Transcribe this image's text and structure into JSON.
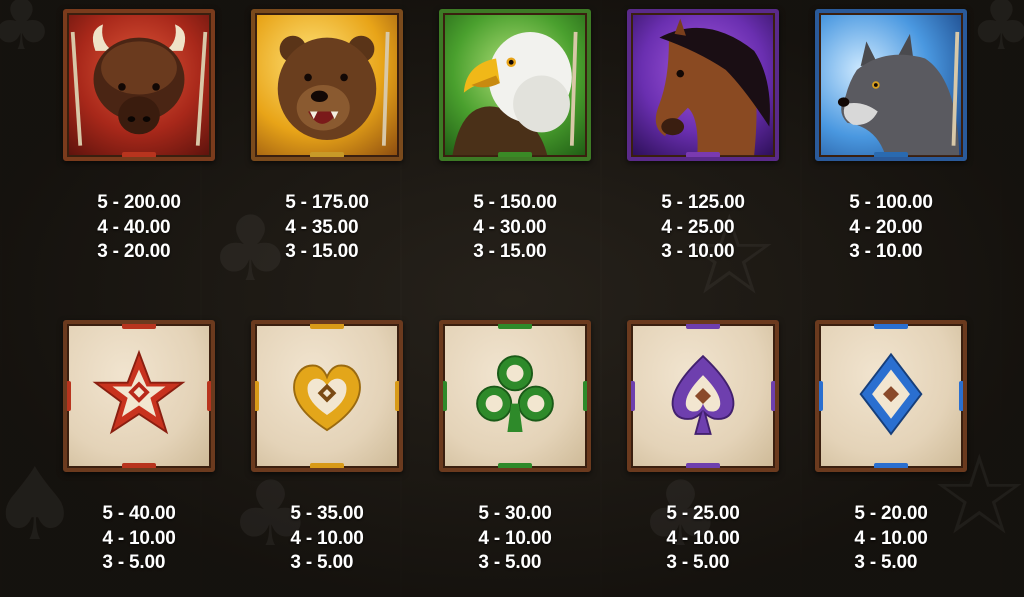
{
  "symbols": [
    {
      "id": "buffalo",
      "icon": "buffalo-icon",
      "bg": "#b3321e",
      "frame": "#7a3b1c",
      "pays": [
        "5 - 200.00",
        "4 - 40.00",
        "3 - 20.00"
      ]
    },
    {
      "id": "bear",
      "icon": "bear-icon",
      "bg": "#e8b020",
      "frame": "#7a4a1c",
      "pays": [
        "5 - 175.00",
        "4 - 35.00",
        "3 - 15.00"
      ]
    },
    {
      "id": "eagle",
      "icon": "eagle-icon",
      "bg": "#3f9a2e",
      "frame": "#3d7a25",
      "pays": [
        "5 - 150.00",
        "4 - 30.00",
        "3 - 15.00"
      ]
    },
    {
      "id": "horse",
      "icon": "horse-icon",
      "bg": "#6a2fb0",
      "frame": "#5a2a8a",
      "pays": [
        "5 - 125.00",
        "4 - 25.00",
        "3 - 10.00"
      ]
    },
    {
      "id": "wolf",
      "icon": "wolf-icon",
      "bg": "#2f7fd0",
      "frame": "#2a5a9a",
      "pays": [
        "5 - 100.00",
        "4 - 20.00",
        "3 - 10.00"
      ]
    },
    {
      "id": "star",
      "icon": "star-icon",
      "bg": "#c8321e",
      "bead": "#b8341e",
      "pays": [
        "5 - 40.00",
        "4 - 10.00",
        "3 - 5.00"
      ]
    },
    {
      "id": "heart",
      "icon": "heart-icon",
      "bg": "#e3a61a",
      "bead": "#d89a18",
      "pays": [
        "5 - 35.00",
        "4 - 10.00",
        "3 - 5.00"
      ]
    },
    {
      "id": "club",
      "icon": "club-icon",
      "bg": "#2e8a2a",
      "bead": "#2e8a2a",
      "pays": [
        "5 - 30.00",
        "4 - 10.00",
        "3 - 5.00"
      ]
    },
    {
      "id": "spade",
      "icon": "spade-icon",
      "bg": "#6e3fae",
      "bead": "#6e3fae",
      "pays": [
        "5 - 25.00",
        "4 - 10.00",
        "3 - 5.00"
      ]
    },
    {
      "id": "diamond",
      "icon": "diamond-icon",
      "bg": "#2a6fd0",
      "bead": "#2a6fd0",
      "pays": [
        "5 - 20.00",
        "4 - 10.00",
        "3 - 5.00"
      ]
    }
  ]
}
